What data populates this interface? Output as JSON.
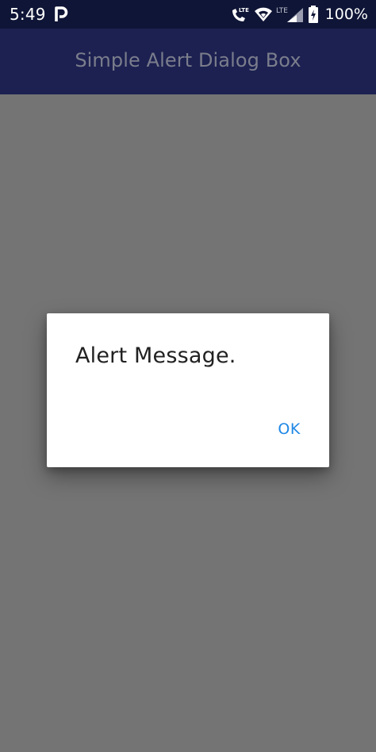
{
  "status_bar": {
    "time": "5:49",
    "battery_percent": "100%",
    "icons": [
      "parking-p-icon",
      "lte-call-icon",
      "wifi-icon",
      "lte-signal-icon",
      "battery-charging-icon"
    ],
    "lte_label": "LTE"
  },
  "app_bar": {
    "title": "Simple Alert Dialog Box",
    "background": "#1c2151",
    "title_color": "#7b7d8c"
  },
  "dialog": {
    "message": "Alert Message.",
    "ok_label": "OK",
    "accent_color": "#1e88e5"
  },
  "scrim_color": "#747474"
}
